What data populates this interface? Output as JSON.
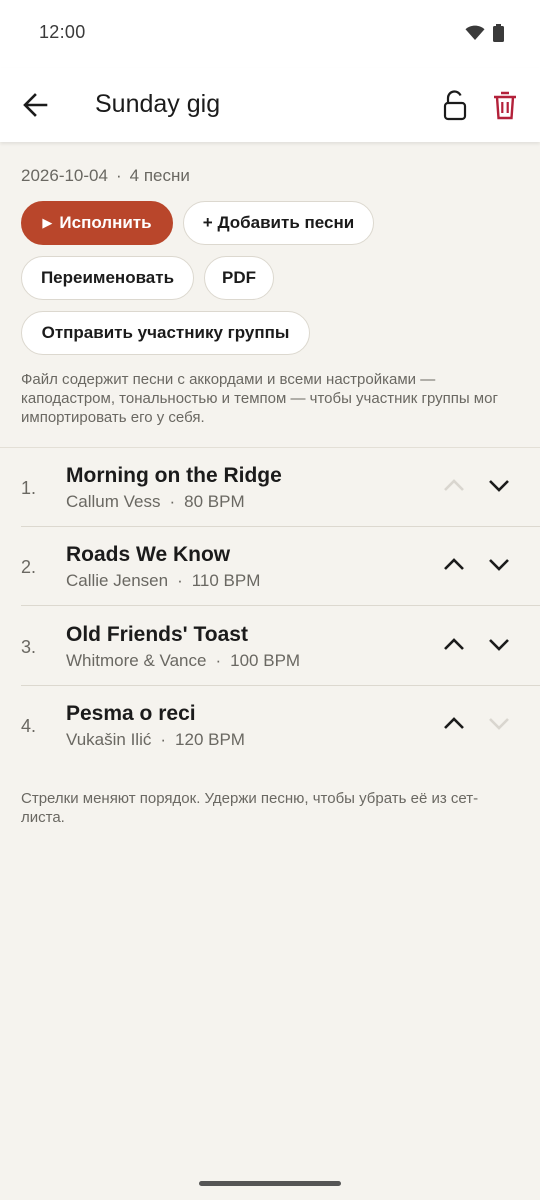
{
  "status_bar": {
    "time": "12:00",
    "icons": [
      "wifi-icon",
      "battery-icon"
    ]
  },
  "app_bar": {
    "title": "Sunday gig",
    "back_icon": "arrow-left-icon",
    "lock_icon": "lock-open-icon",
    "delete_icon": "trash-icon",
    "delete_color": "#b3213a"
  },
  "setlist": {
    "date": "2026-10-04",
    "separator": "·",
    "song_count": "4 песни"
  },
  "actions": {
    "perform_label": "Исполнить",
    "perform_icon": "play-icon",
    "add_songs_label": "+ Добавить песни",
    "rename_label": "Переименовать",
    "pdf_label": "PDF",
    "send_label": "Отправить участнику группы"
  },
  "help_text": "Файл содержит песни с аккордами и всеми настройками — каподастром, тональностью и темпом — чтобы участник группы мог импортировать его у себя.",
  "songs": [
    {
      "number": "1.",
      "title": "Morning on the Ridge",
      "artist": "Callum Vess",
      "bpm": "80 BPM",
      "up_enabled": false,
      "down_enabled": true
    },
    {
      "number": "2.",
      "title": "Roads We Know",
      "artist": "Callie Jensen",
      "bpm": "110 BPM",
      "up_enabled": true,
      "down_enabled": true
    },
    {
      "number": "3.",
      "title": "Old Friends' Toast",
      "artist": "Whitmore & Vance",
      "bpm": "100 BPM",
      "up_enabled": true,
      "down_enabled": true
    },
    {
      "number": "4.",
      "title": "Pesma o reci",
      "artist": "Vukašin Ilić",
      "bpm": "120 BPM",
      "up_enabled": true,
      "down_enabled": false
    }
  ],
  "footer_note": "Стрелки меняют порядок. Удержи песню, чтобы убрать её из сет-листа.",
  "colors": {
    "accent": "#b9462b",
    "background": "#f5f3ee",
    "surface": "#ffffff",
    "muted_text": "#6a6862",
    "arrow_enabled": "#1b1b1b",
    "arrow_disabled": "#d9d6cf"
  }
}
